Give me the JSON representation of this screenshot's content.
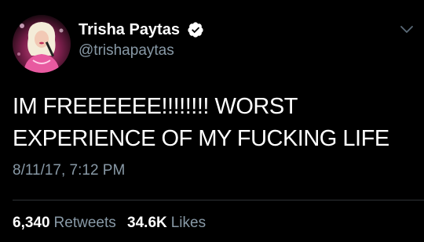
{
  "profile": {
    "display_name": "Trisha Paytas",
    "handle": "@trishapaytas",
    "verified": true,
    "avatar_icon": "profile-photo"
  },
  "tweet": {
    "text": "IM FREEEEEE!!!!!!!! WORST EXPERIENCE OF MY FUCKING LIFE",
    "timestamp": "8/11/17, 7:12 PM"
  },
  "stats": {
    "retweets_count": "6,340",
    "retweets_label": "Retweets",
    "likes_count": "34.6K",
    "likes_label": "Likes"
  },
  "colors": {
    "background": "#000000",
    "primary_text": "#ffffff",
    "secondary_text": "#8899a6",
    "verified_badge": "#ffffff"
  },
  "icons": {
    "verified": "verified-badge-icon",
    "menu": "chevron-down-icon"
  }
}
